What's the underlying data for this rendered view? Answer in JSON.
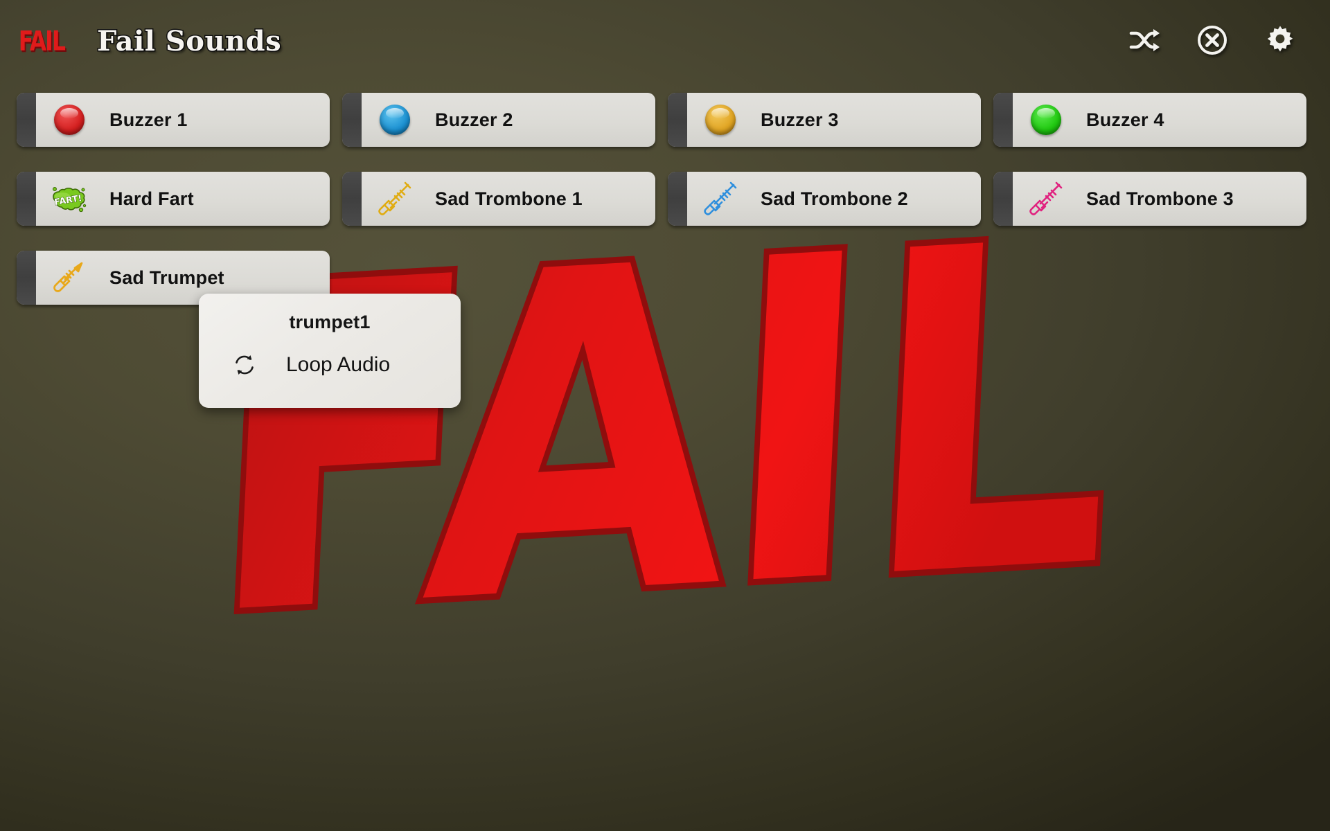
{
  "app": {
    "logo_text": "FAIL",
    "title": "Fail Sounds",
    "background_color": "#4e4b34",
    "watermark_text": "FAIL",
    "watermark_fill": "#e01111",
    "watermark_stroke": "#8f0d0d"
  },
  "header": {
    "actions": [
      {
        "name": "shuffle-icon",
        "label": "Shuffle"
      },
      {
        "name": "stop-icon",
        "label": "Stop All"
      },
      {
        "name": "gear-icon",
        "label": "Settings"
      }
    ]
  },
  "sounds": [
    {
      "label": "Buzzer 1",
      "icon": "red-ball-icon",
      "color": "#d41f1f"
    },
    {
      "label": "Buzzer 2",
      "icon": "blue-ball-icon",
      "color": "#1a8fd0"
    },
    {
      "label": "Buzzer 3",
      "icon": "orange-ball-icon",
      "color": "#e0a422"
    },
    {
      "label": "Buzzer 4",
      "icon": "green-ball-icon",
      "color": "#1fc80f"
    },
    {
      "label": "Hard Fart",
      "icon": "fart-cloud-icon",
      "color": "#7ac922",
      "badge_text": "FART!"
    },
    {
      "label": "Sad Trombone 1",
      "icon": "trombone-icon",
      "color": "#e0ac12"
    },
    {
      "label": "Sad Trombone 2",
      "icon": "trombone-icon",
      "color": "#2f8fdd"
    },
    {
      "label": "Sad Trombone 3",
      "icon": "trombone-icon",
      "color": "#e0227f"
    },
    {
      "label": "Sad Trumpet",
      "icon": "trumpet-icon",
      "color": "#e8a81a"
    }
  ],
  "context_menu": {
    "title": "trumpet1",
    "items": [
      {
        "label": "Loop Audio",
        "icon": "loop-icon"
      }
    ]
  }
}
